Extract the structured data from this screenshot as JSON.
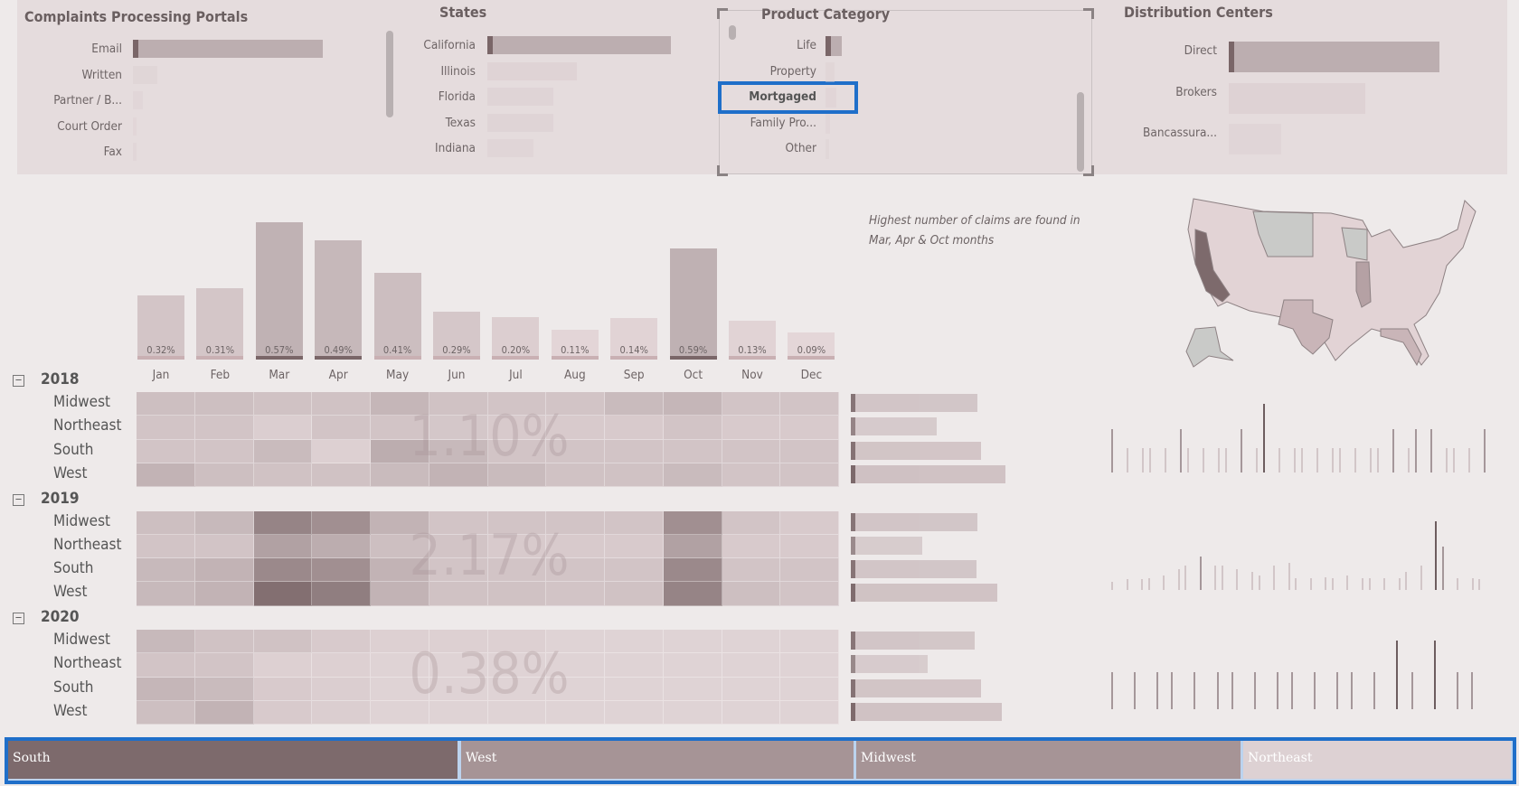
{
  "colors": {
    "accent": "#1f6fc9",
    "bar": "#bcaeb0",
    "dark": "#7a6668",
    "background": "#eeeaea"
  },
  "portals": {
    "title": "Complaints Processing Portals",
    "items": [
      {
        "label": "Email",
        "value": 1.0
      },
      {
        "label": "Written",
        "value": 0.13
      },
      {
        "label": "Partner / B...",
        "value": 0.05
      },
      {
        "label": "Court Order",
        "value": 0.02
      },
      {
        "label": "Fax",
        "value": 0.01
      }
    ]
  },
  "states": {
    "title": "States",
    "items": [
      {
        "label": "California",
        "value": 1.0
      },
      {
        "label": "Illinois",
        "value": 0.49
      },
      {
        "label": "Florida",
        "value": 0.36
      },
      {
        "label": "Texas",
        "value": 0.36
      },
      {
        "label": "Indiana",
        "value": 0.25
      }
    ]
  },
  "product_category": {
    "title": "Product Category",
    "items": [
      {
        "label": "Life",
        "value": 0.18
      },
      {
        "label": "Property",
        "value": 0.1
      },
      {
        "label": "Mortgaged",
        "value": 0.12,
        "selected": true
      },
      {
        "label": "Family Pro...",
        "value": 0.05
      },
      {
        "label": "Other",
        "value": 0.03
      }
    ]
  },
  "distribution": {
    "title": "Distribution Centers",
    "items": [
      {
        "label": "Direct",
        "value": 1.0
      },
      {
        "label": "Brokers",
        "value": 0.65
      },
      {
        "label": "Bancassura...",
        "value": 0.25
      }
    ]
  },
  "annotation": {
    "line1": "Highest number of claims are found in",
    "line2": "Mar, Apr & Oct months"
  },
  "chart_data": [
    {
      "type": "bar",
      "categories": [
        "Jan",
        "Feb",
        "Mar",
        "Apr",
        "May",
        "Jun",
        "Jul",
        "Aug",
        "Sep",
        "Oct",
        "Nov",
        "Dec"
      ],
      "values": [
        0.32,
        0.31,
        0.57,
        0.49,
        0.41,
        0.29,
        0.2,
        0.11,
        0.14,
        0.59,
        0.13,
        0.09
      ],
      "labels": [
        "0.32%",
        "0.31%",
        "0.57%",
        "0.49%",
        "0.41%",
        "0.29%",
        "0.20%",
        "0.11%",
        "0.14%",
        "0.59%",
        "0.13%",
        "0.09%"
      ],
      "heights": [
        0.47,
        0.52,
        1.0,
        0.87,
        0.63,
        0.35,
        0.31,
        0.22,
        0.3,
        0.81,
        0.28,
        0.2
      ]
    },
    {
      "type": "heatmap",
      "columns": [
        "Jan",
        "Feb",
        "Mar",
        "Apr",
        "May",
        "Jun",
        "Jul",
        "Aug",
        "Sep",
        "Oct",
        "Nov",
        "Dec"
      ],
      "groups": [
        {
          "year": "2018",
          "total": "1.10%",
          "rows": [
            {
              "region": "Midwest",
              "values": [
                0.25,
                0.25,
                0.22,
                0.22,
                0.32,
                0.22,
                0.2,
                0.2,
                0.28,
                0.32,
                0.2,
                0.2
              ],
              "bar": 0.78
            },
            {
              "region": "Northeast",
              "values": [
                0.2,
                0.2,
                0.12,
                0.2,
                0.2,
                0.18,
                0.15,
                0.15,
                0.15,
                0.2,
                0.15,
                0.15
              ],
              "bar": 0.53
            },
            {
              "region": "South",
              "values": [
                0.2,
                0.2,
                0.28,
                0.1,
                0.4,
                0.3,
                0.2,
                0.2,
                0.2,
                0.2,
                0.2,
                0.2
              ],
              "bar": 0.8
            },
            {
              "region": "West",
              "values": [
                0.35,
                0.25,
                0.22,
                0.22,
                0.28,
                0.35,
                0.28,
                0.22,
                0.22,
                0.28,
                0.2,
                0.2
              ],
              "bar": 0.95
            }
          ]
        },
        {
          "year": "2019",
          "total": "2.17%",
          "rows": [
            {
              "region": "Midwest",
              "values": [
                0.25,
                0.3,
                0.75,
                0.65,
                0.35,
                0.2,
                0.2,
                0.2,
                0.2,
                0.65,
                0.2,
                0.15
              ],
              "bar": 0.78
            },
            {
              "region": "Northeast",
              "values": [
                0.2,
                0.2,
                0.5,
                0.4,
                0.25,
                0.2,
                0.15,
                0.15,
                0.15,
                0.5,
                0.15,
                0.15
              ],
              "bar": 0.44
            },
            {
              "region": "South",
              "values": [
                0.3,
                0.35,
                0.7,
                0.65,
                0.35,
                0.2,
                0.2,
                0.2,
                0.2,
                0.7,
                0.2,
                0.2
              ],
              "bar": 0.77
            },
            {
              "region": "West",
              "values": [
                0.3,
                0.35,
                0.92,
                0.8,
                0.35,
                0.22,
                0.22,
                0.2,
                0.22,
                0.75,
                0.25,
                0.2
              ],
              "bar": 0.9
            }
          ]
        },
        {
          "year": "2020",
          "total": "0.38%",
          "rows": [
            {
              "region": "Midwest",
              "values": [
                0.3,
                0.22,
                0.22,
                0.15,
                0.1,
                0.1,
                0.1,
                0.08,
                0.08,
                0.08,
                0.08,
                0.08
              ],
              "bar": 0.76
            },
            {
              "region": "Northeast",
              "values": [
                0.2,
                0.2,
                0.1,
                0.1,
                0.08,
                0.08,
                0.08,
                0.08,
                0.08,
                0.08,
                0.08,
                0.08
              ],
              "bar": 0.47
            },
            {
              "region": "South",
              "values": [
                0.32,
                0.28,
                0.15,
                0.12,
                0.08,
                0.08,
                0.08,
                0.08,
                0.08,
                0.08,
                0.08,
                0.08
              ],
              "bar": 0.8
            },
            {
              "region": "West",
              "values": [
                0.25,
                0.35,
                0.15,
                0.12,
                0.08,
                0.08,
                0.08,
                0.08,
                0.08,
                0.08,
                0.08,
                0.08
              ],
              "bar": 0.93
            }
          ]
        }
      ]
    }
  ],
  "spikes": [
    [
      0.6,
      0.3,
      0.3,
      0.3,
      0.3,
      0.6,
      0.3,
      0.3,
      0.3,
      0.3,
      0.6,
      0.3,
      1.0,
      0.3,
      0.3,
      0.3,
      0.3,
      0.3,
      0.3,
      0.3,
      0.3,
      0.3,
      0.6,
      0.3,
      0.6,
      0.6,
      0.3,
      0.3,
      0.3,
      0.6
    ],
    [
      0.05,
      0.08,
      0.08,
      0.1,
      0.15,
      0.25,
      0.3,
      0.45,
      0.3,
      0.3,
      0.25,
      0.2,
      0.15,
      0.3,
      0.35,
      0.1,
      0.1,
      0.12,
      0.1,
      0.15,
      0.1,
      0.1,
      0.1,
      0.1,
      0.2,
      0.3,
      1.0,
      0.6,
      0.1,
      0.1,
      0.08
    ],
    [
      0.5,
      0.5,
      0.5,
      0.5,
      0.5,
      0.5,
      0.5,
      0.5,
      0.5,
      0.5,
      0.5,
      0.5,
      0.5,
      0.5,
      1.0,
      0.5,
      1.0,
      0.5,
      0.5
    ]
  ],
  "region_slicer": [
    {
      "label": "South",
      "share": 0.28,
      "color": "#7d6a6c"
    },
    {
      "label": "West",
      "share": 0.25,
      "color": "#a69496"
    },
    {
      "label": "Midwest",
      "share": 0.25,
      "color": "#a69496"
    },
    {
      "label": "Northeast",
      "share": 0.18,
      "color": "#ddd1d3"
    }
  ]
}
